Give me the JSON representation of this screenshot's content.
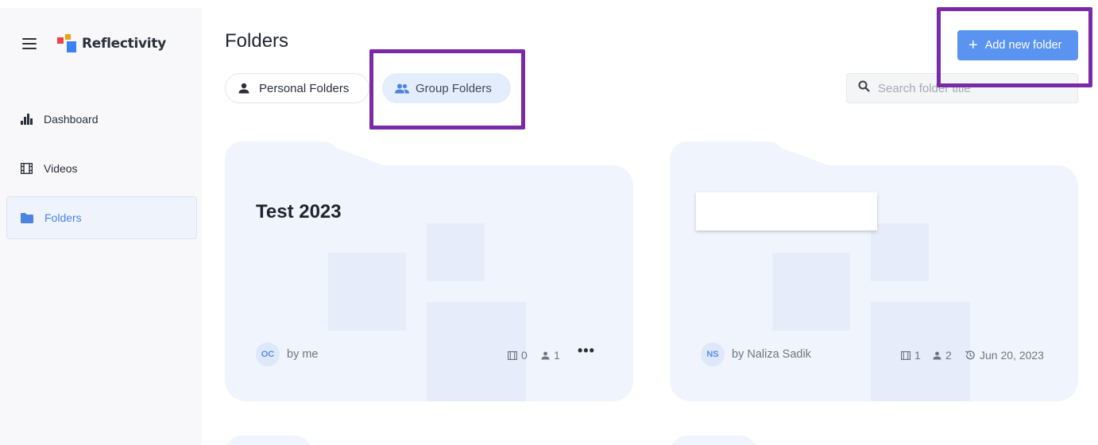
{
  "app": {
    "name": "Reflectivity"
  },
  "sidebar": {
    "items": [
      {
        "label": "Dashboard",
        "icon": "dashboard-icon"
      },
      {
        "label": "Videos",
        "icon": "film-icon"
      },
      {
        "label": "Folders",
        "icon": "folder-icon",
        "active": true
      }
    ]
  },
  "header": {
    "title": "Folders",
    "add_button_label": "Add new folder"
  },
  "filters": {
    "personal_label": "Personal Folders",
    "group_label": "Group Folders",
    "selected": "Group Folders"
  },
  "search": {
    "placeholder": "Search folder title",
    "value": ""
  },
  "folders": [
    {
      "title": "Test 2023",
      "initials": "OC",
      "owner": "by me",
      "videos": "0",
      "members": "1",
      "date": ""
    },
    {
      "title": "",
      "initials": "NS",
      "owner": "by Naliza Sadik",
      "videos": "1",
      "members": "2",
      "date": "Jun 20, 2023"
    }
  ],
  "colors": {
    "accent": "#5a93f0",
    "highlight_box": "#7a2aa6",
    "card_bg": "#f0f4fc",
    "active_nav_text": "#4b83e0"
  }
}
